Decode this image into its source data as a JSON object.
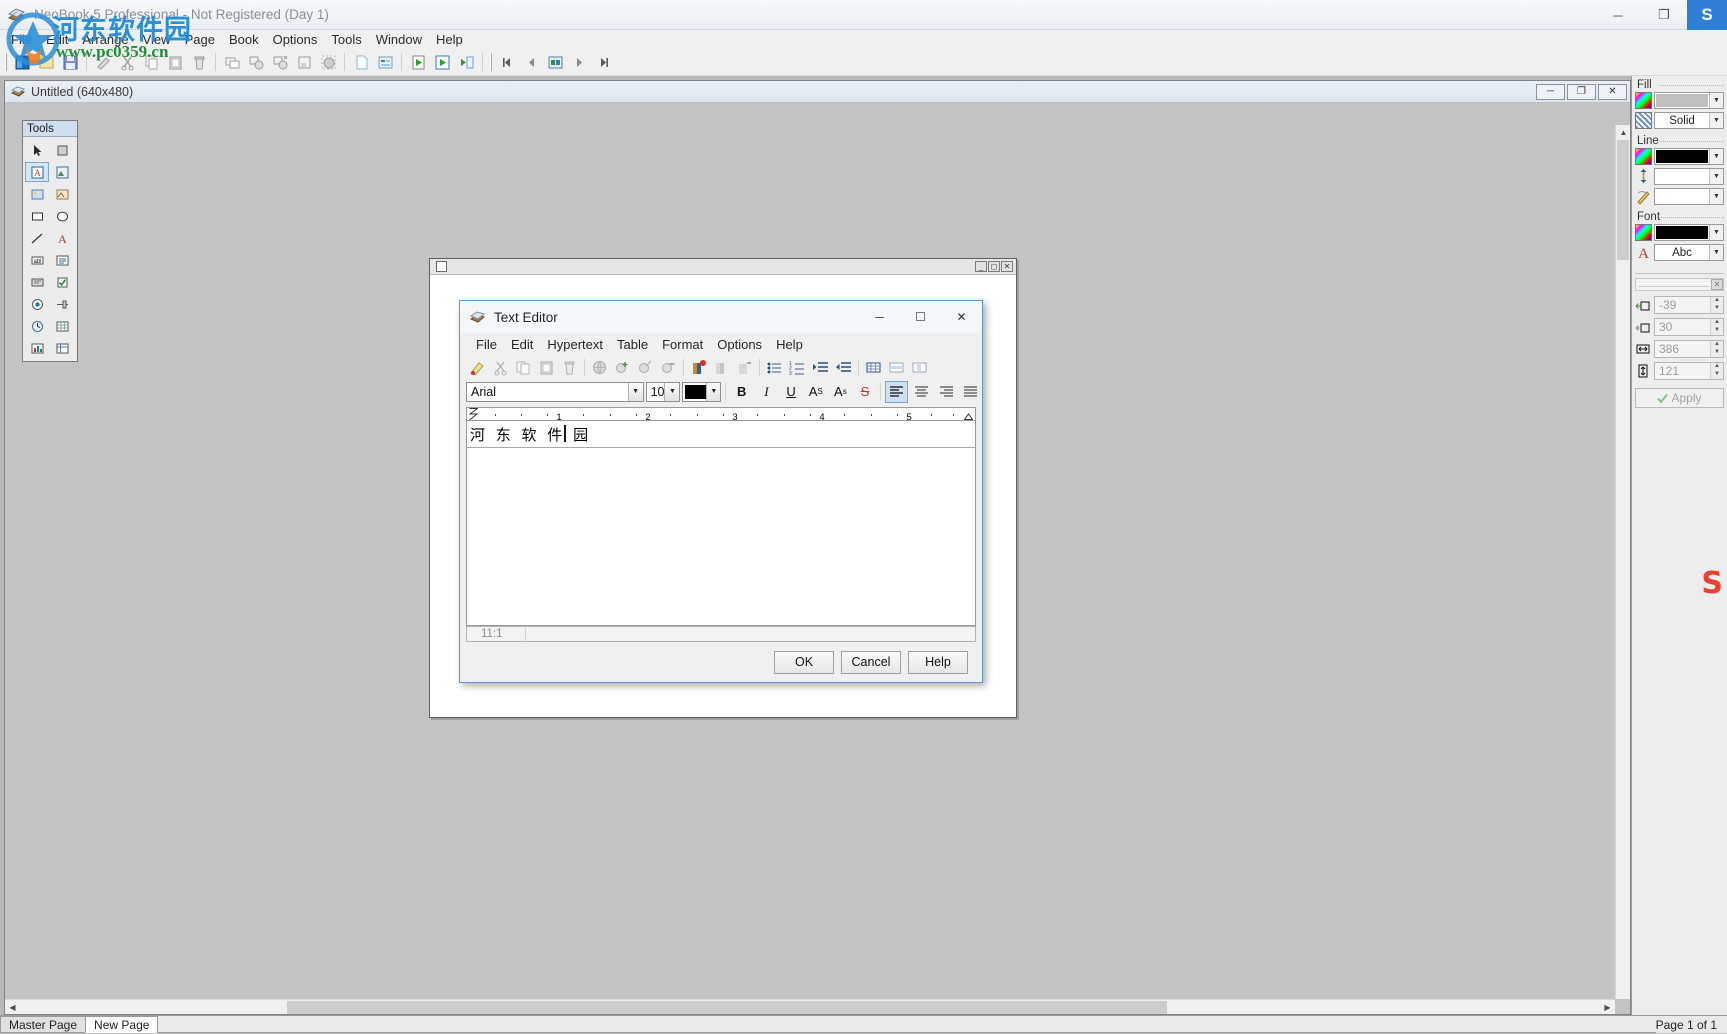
{
  "app": {
    "title": "NeoBook 5 Professional - Not Registered (Day 1)",
    "icon": "neobook-icon",
    "window_buttons": {
      "minimize": "─",
      "maximize": "❐",
      "logo": "S"
    }
  },
  "menubar": {
    "items": [
      "File",
      "Edit",
      "Arrange",
      "View",
      "Page",
      "Book",
      "Options",
      "Tools",
      "Window",
      "Help"
    ]
  },
  "toolbar": {
    "groups": [
      [
        "new-book-icon",
        "open-book-icon",
        "save-book-icon"
      ],
      [
        "eraser-icon",
        "cut-icon",
        "copy-icon",
        "paste-icon",
        "delete-icon"
      ],
      [
        "duplicate-icon",
        "group-icon",
        "ungroup-icon",
        "align-icon",
        "select-all-icon"
      ],
      [
        "new-page-icon",
        "page-properties-icon"
      ],
      [
        "run-icon",
        "run-from-start-icon",
        "compile-icon"
      ]
    ],
    "nav": [
      "first-page-icon",
      "previous-page-icon",
      "page-list-icon",
      "next-page-icon",
      "last-page-icon"
    ]
  },
  "document": {
    "title": "Untitled (640x480)",
    "icon": "document-icon",
    "window_buttons": [
      "─",
      "❐",
      "✕"
    ]
  },
  "tools_palette": {
    "caption": "Tools",
    "items": [
      "pointer-icon",
      "select-rect-icon",
      "text-object-icon",
      "picture-object-icon",
      "image-icon",
      "metafile-icon",
      "rectangle-icon",
      "ellipse-icon",
      "line-icon",
      "rich-text-icon",
      "edit-field-icon",
      "list-box-icon",
      "push-button-icon",
      "check-box-icon",
      "radio-button-icon",
      "slider-icon",
      "timer-icon",
      "grid-icon",
      "chart-icon",
      "table-icon"
    ]
  },
  "properties": {
    "fill": {
      "label": "Fill",
      "color_icon": "color-picker-icon",
      "color_value": "",
      "pattern_icon": "pattern-icon",
      "pattern_value": "Solid"
    },
    "line": {
      "label": "Line",
      "color_icon": "color-picker-icon",
      "color_value": "",
      "width_icon": "line-width-icon",
      "width_value": "",
      "style_icon": "line-style-icon",
      "style_value": ""
    },
    "font": {
      "label": "Font",
      "color_icon": "color-picker-icon",
      "color_value": "",
      "face_icon": "font-icon",
      "face_value": "Abc"
    },
    "geometry": {
      "left_icon": "position-x-icon",
      "left": "-39",
      "top_icon": "position-y-icon",
      "top": "30",
      "width_icon": "width-icon",
      "width": "386",
      "height_icon": "height-icon",
      "height": "121"
    },
    "apply_label": "Apply",
    "apply_icon": "check-icon"
  },
  "page_tabs": {
    "tabs": [
      {
        "label": "Master Page",
        "active": false
      },
      {
        "label": "New Page",
        "active": true
      }
    ],
    "status": "Page 1 of 1"
  },
  "text_editor": {
    "title": "Text Editor",
    "icon": "neobook-icon",
    "window_buttons": {
      "minimize": "─",
      "maximize": "☐",
      "close": "✕"
    },
    "menu": [
      "File",
      "Edit",
      "Hypertext",
      "Table",
      "Format",
      "Options",
      "Help"
    ],
    "toolbar": [
      "highlighter-icon",
      "cut-icon",
      "copy-icon",
      "paste-icon",
      "delete-icon",
      "hyperlink-globe-icon",
      "add-link-icon",
      "edit-link-icon",
      "remove-link-icon",
      "add-bookmark-icon",
      "edit-bookmark-icon",
      "remove-bookmark-icon",
      "bullet-list-icon",
      "numbered-list-icon",
      "increase-indent-icon",
      "decrease-indent-icon",
      "insert-table-icon",
      "insert-row-icon",
      "insert-cell-icon"
    ],
    "format_bar": {
      "font_name": "Arial",
      "font_size": "10",
      "font_color": "#000000",
      "bold": "B",
      "italic": "I",
      "underline": "U",
      "superscript": "A",
      "superscript_sup": "S",
      "subscript": "A",
      "subscript_sub": "s",
      "strikethrough": "S",
      "align_left_icon": "align-left-icon",
      "align_center_icon": "align-center-icon",
      "align_right_icon": "align-right-icon",
      "align_justify_icon": "align-justify-icon"
    },
    "ruler": {
      "ticks": [
        "1",
        "2",
        "3",
        "4",
        "5"
      ]
    },
    "content": "河 东 软 件 园",
    "status": "11:1",
    "buttons": {
      "ok": "OK",
      "cancel": "Cancel",
      "help": "Help"
    }
  },
  "watermark": {
    "brand": "河东软件园",
    "url": "www.pc0359.cn",
    "corner": "S"
  },
  "colors": {
    "accent": "#2f7fd6",
    "title_text": "#8a8f96",
    "desktop": "#c3c3c3",
    "panel": "#ededed",
    "dialog_border": "#5b9ad1",
    "watermark_blue": "#2b8fd6",
    "watermark_green": "#1f8f3a"
  }
}
